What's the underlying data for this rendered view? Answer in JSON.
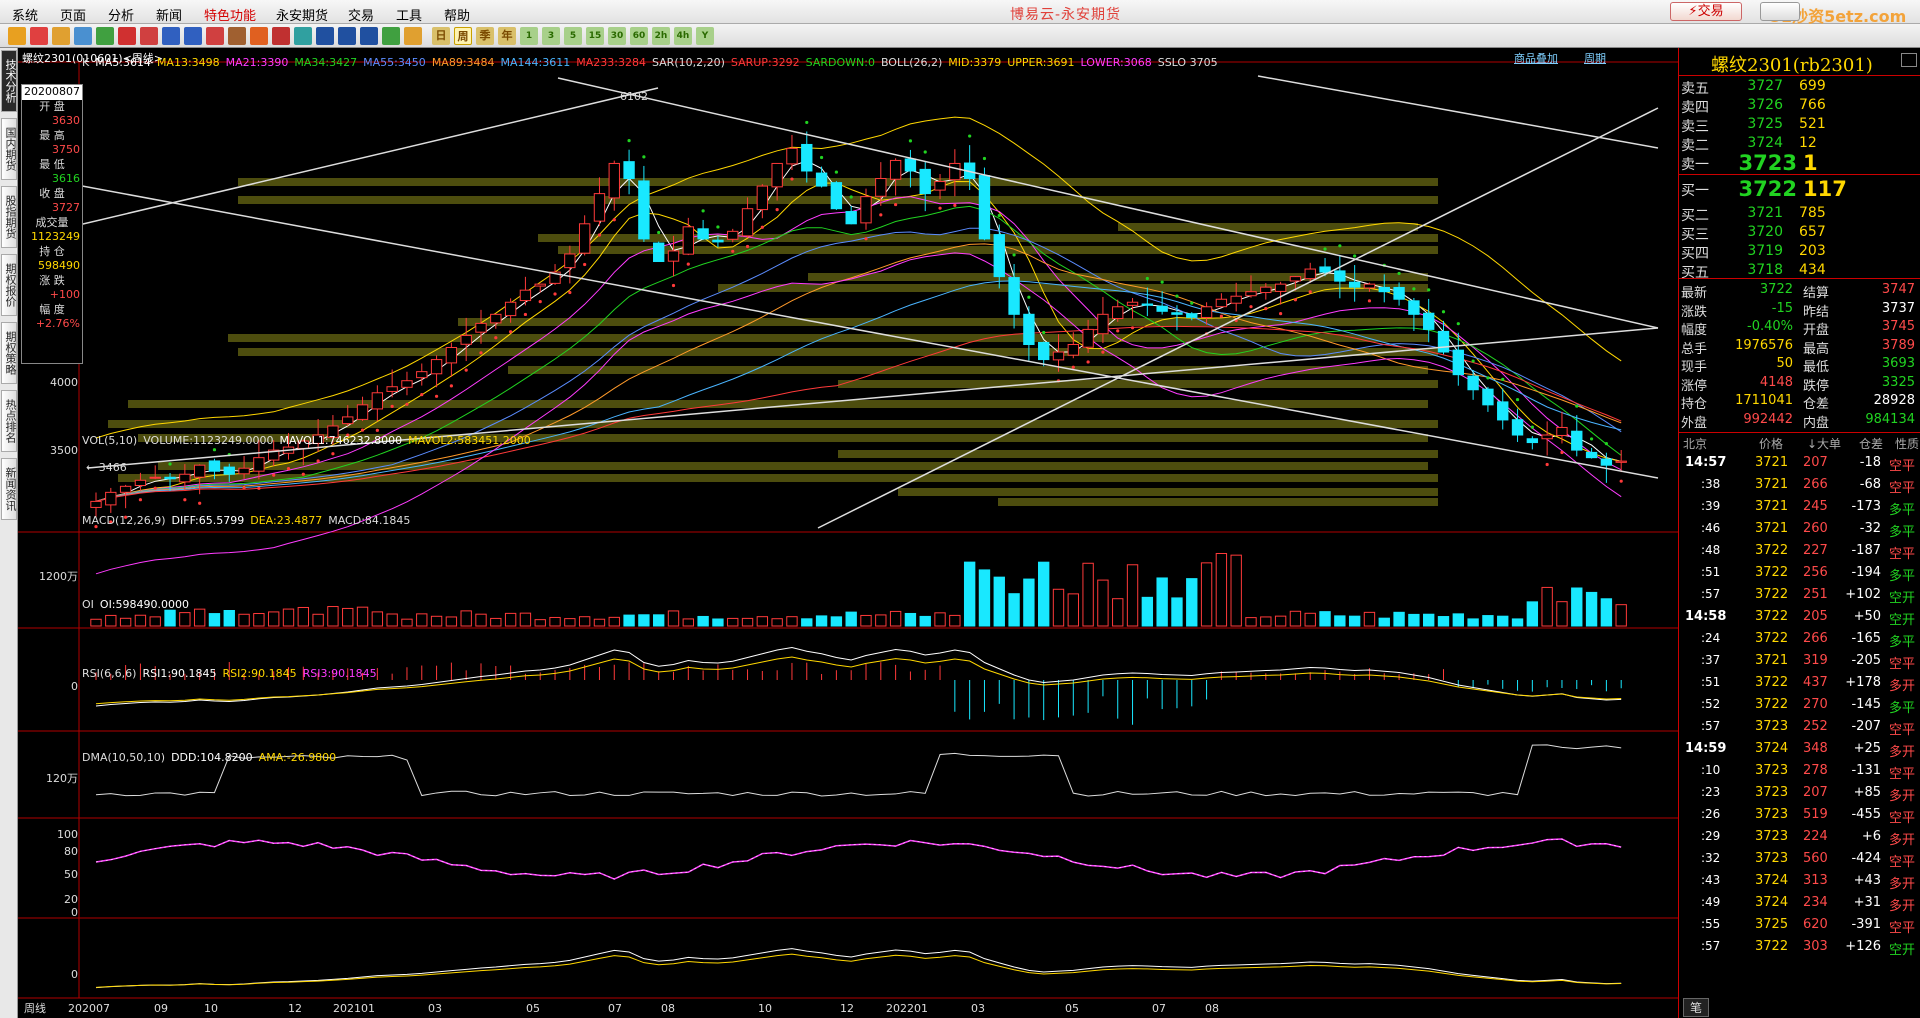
{
  "menu": [
    "系统",
    "页面",
    "分析",
    "新闻",
    "特色功能",
    "永安期货",
    "交易",
    "工具",
    "帮助"
  ],
  "menu_active": 4,
  "app_title": "博易云-永安期货",
  "trade_button": "交易",
  "watermark": "5E炒资5etz.com",
  "toolbar_period_buttons": [
    "日",
    "周",
    "季",
    "年",
    "1",
    "3",
    "5",
    "15",
    "30",
    "60",
    "2h",
    "4h",
    "Y"
  ],
  "left_tabs": [
    "技术分析",
    "国内期货",
    "股指期货",
    "期权报价",
    "期权策略",
    "热点排名",
    "新闻资讯"
  ],
  "chart": {
    "title": "螺纹2301(010601)<周线>",
    "links": [
      "商品叠加",
      "周期"
    ],
    "ma_legend": [
      {
        "text": "K",
        "color": "#ddd"
      },
      {
        "text": "MA5:3614",
        "color": "#fff"
      },
      {
        "text": "MA13:3498",
        "color": "#ffd700"
      },
      {
        "text": "MA21:3390",
        "color": "#ff3cff"
      },
      {
        "text": "MA34:3427",
        "color": "#21d321"
      },
      {
        "text": "MA55:3450",
        "color": "#5b8cff"
      },
      {
        "text": "MA89:3484",
        "color": "#ff9a2a"
      },
      {
        "text": "MA144:3611",
        "color": "#4ab4ff"
      },
      {
        "text": "MA233:3284",
        "color": "#ff3a3a"
      },
      {
        "text": "SAR(10,2,20)",
        "color": "#ddd"
      },
      {
        "text": "SARUP:3292",
        "color": "#ff3a3a"
      },
      {
        "text": "SARDOWN:0",
        "color": "#21d321"
      },
      {
        "text": "BOLL(26,2)",
        "color": "#ddd"
      },
      {
        "text": "MID:3379",
        "color": "#ffd700"
      },
      {
        "text": "UPPER:3691",
        "color": "#ffd700"
      },
      {
        "text": "LOWER:3068",
        "color": "#ff3cff"
      },
      {
        "text": "SSLO 3705",
        "color": "#ddd"
      }
    ],
    "price_labels": [
      "4000",
      "3500"
    ],
    "high_label": "6102",
    "low_label": "3466",
    "info_box": {
      "date": "20200807",
      "items": [
        {
          "k": "开  盘",
          "v": "3630",
          "c": "red"
        },
        {
          "k": "最  高",
          "v": "3750",
          "c": "red"
        },
        {
          "k": "最  低",
          "v": "3616",
          "c": "grn"
        },
        {
          "k": "收  盘",
          "v": "3727",
          "c": "red"
        },
        {
          "k": "成交量",
          "v": "1123249",
          "c": "yel"
        },
        {
          "k": "持  仓",
          "v": "598490",
          "c": "yel"
        },
        {
          "k": "涨  跌",
          "v": "+100",
          "c": "red"
        },
        {
          "k": "幅  度",
          "v": "+2.76%",
          "c": "red"
        }
      ]
    },
    "vol_legend": [
      {
        "text": "VOL(5,10)",
        "color": "#ddd"
      },
      {
        "text": "VOLUME:1123249.0000",
        "color": "#ddd"
      },
      {
        "text": "MAVOL1:746232.8000",
        "color": "#fff"
      },
      {
        "text": "MAVOL2:583451.2000",
        "color": "#ffd700"
      }
    ],
    "vol_label": "1200万",
    "macd_legend": [
      {
        "text": "MACD(12,26,9)",
        "color": "#ddd"
      },
      {
        "text": "DIFF:65.5799",
        "color": "#fff"
      },
      {
        "text": "DEA:23.4877",
        "color": "#ffd700"
      },
      {
        "text": "MACD:84.1845",
        "color": "#ddd"
      }
    ],
    "macd_label": "0",
    "oi_legend": [
      {
        "text": "OI",
        "color": "#ddd"
      },
      {
        "text": "OI:598490.0000",
        "color": "#fff"
      }
    ],
    "oi_label": "120万",
    "rsi_legend": [
      {
        "text": "RSI(6,6,6)",
        "color": "#ddd"
      },
      {
        "text": "RSI1:90.1845",
        "color": "#fff"
      },
      {
        "text": "RSI2:90.1845",
        "color": "#ffd700"
      },
      {
        "text": "RSI3:90.1845",
        "color": "#ff3cff"
      }
    ],
    "rsi_labels": [
      "100",
      "80",
      "50",
      "20",
      "0"
    ],
    "dma_legend": [
      {
        "text": "DMA(10,50,10)",
        "color": "#ddd"
      },
      {
        "text": "DDD:104.8200",
        "color": "#fff"
      },
      {
        "text": "AMA:-26.9800",
        "color": "#ffd700"
      }
    ],
    "dma_label": "0",
    "axis_name": "周线",
    "x_ticks": [
      "202007",
      "09",
      "10",
      "12",
      "202101",
      "03",
      "05",
      "07",
      "08",
      "10",
      "12",
      "202201",
      "03",
      "05",
      "07",
      "08"
    ]
  },
  "quote": {
    "title": "螺纹2301(rb2301)",
    "asks": [
      {
        "label": "卖五",
        "price": "3727",
        "vol": "699"
      },
      {
        "label": "卖四",
        "price": "3726",
        "vol": "766"
      },
      {
        "label": "卖三",
        "price": "3725",
        "vol": "521"
      },
      {
        "label": "卖二",
        "price": "3724",
        "vol": "12"
      },
      {
        "label": "卖一",
        "price": "3723",
        "vol": "1"
      }
    ],
    "bids": [
      {
        "label": "买一",
        "price": "3722",
        "vol": "117"
      },
      {
        "label": "买二",
        "price": "3721",
        "vol": "785"
      },
      {
        "label": "买三",
        "price": "3720",
        "vol": "657"
      },
      {
        "label": "买四",
        "price": "3719",
        "vol": "203"
      },
      {
        "label": "买五",
        "price": "3718",
        "vol": "434"
      }
    ],
    "stats": [
      {
        "k1": "最新",
        "v1": "3722",
        "c1": "grn",
        "k2": "结算",
        "v2": "3747",
        "c2": "red"
      },
      {
        "k1": "涨跌",
        "v1": "-15",
        "c1": "grn",
        "k2": "昨结",
        "v2": "3737",
        "c2": "wht"
      },
      {
        "k1": "幅度",
        "v1": "-0.40%",
        "c1": "grn",
        "k2": "开盘",
        "v2": "3745",
        "c2": "red"
      },
      {
        "k1": "总手",
        "v1": "1976576",
        "c1": "yel",
        "k2": "最高",
        "v2": "3789",
        "c2": "red"
      },
      {
        "k1": "现手",
        "v1": "50",
        "c1": "yel",
        "k2": "最低",
        "v2": "3693",
        "c2": "grn"
      },
      {
        "k1": "涨停",
        "v1": "4148",
        "c1": "red",
        "k2": "跌停",
        "v2": "3325",
        "c2": "grn"
      },
      {
        "k1": "持仓",
        "v1": "1711041",
        "c1": "yel",
        "k2": "仓差",
        "v2": "28928",
        "c2": "wht"
      },
      {
        "k1": "外盘",
        "v1": "992442",
        "c1": "red",
        "k2": "内盘",
        "v2": "984134",
        "c2": "grn"
      }
    ],
    "tick_headers": [
      "北京",
      "价格",
      "↓大单",
      "仓差",
      "性质"
    ],
    "ticks": [
      {
        "t": "14:57",
        "p": "3721",
        "v": "207",
        "d": "-18",
        "n": "空平",
        "c": "red"
      },
      {
        "t": ":38",
        "p": "3721",
        "v": "266",
        "d": "-68",
        "n": "空平",
        "c": "red"
      },
      {
        "t": ":39",
        "p": "3721",
        "v": "245",
        "d": "-173",
        "n": "多平",
        "c": "grn"
      },
      {
        "t": ":46",
        "p": "3721",
        "v": "260",
        "d": "-32",
        "n": "多平",
        "c": "grn"
      },
      {
        "t": ":48",
        "p": "3722",
        "v": "227",
        "d": "-187",
        "n": "空平",
        "c": "red"
      },
      {
        "t": ":51",
        "p": "3722",
        "v": "256",
        "d": "-194",
        "n": "多平",
        "c": "grn"
      },
      {
        "t": ":57",
        "p": "3722",
        "v": "251",
        "d": "+102",
        "n": "空开",
        "c": "grn"
      },
      {
        "t": "14:58",
        "p": "3722",
        "v": "205",
        "d": "+50",
        "n": "空开",
        "c": "grn"
      },
      {
        "t": ":24",
        "p": "3722",
        "v": "266",
        "d": "-165",
        "n": "多平",
        "c": "grn"
      },
      {
        "t": ":37",
        "p": "3721",
        "v": "319",
        "d": "-205",
        "n": "空平",
        "c": "red"
      },
      {
        "t": ":51",
        "p": "3722",
        "v": "437",
        "d": "+178",
        "n": "多开",
        "c": "red"
      },
      {
        "t": ":52",
        "p": "3722",
        "v": "270",
        "d": "-145",
        "n": "多平",
        "c": "grn"
      },
      {
        "t": ":57",
        "p": "3723",
        "v": "252",
        "d": "-207",
        "n": "空平",
        "c": "red"
      },
      {
        "t": "14:59",
        "p": "3724",
        "v": "348",
        "d": "+25",
        "n": "多开",
        "c": "red"
      },
      {
        "t": ":10",
        "p": "3723",
        "v": "278",
        "d": "-131",
        "n": "空平",
        "c": "red"
      },
      {
        "t": ":23",
        "p": "3723",
        "v": "207",
        "d": "+85",
        "n": "多开",
        "c": "red"
      },
      {
        "t": ":26",
        "p": "3723",
        "v": "519",
        "d": "-455",
        "n": "空平",
        "c": "red"
      },
      {
        "t": ":29",
        "p": "3723",
        "v": "224",
        "d": "+6",
        "n": "多开",
        "c": "red"
      },
      {
        "t": ":32",
        "p": "3723",
        "v": "560",
        "d": "-424",
        "n": "空平",
        "c": "red"
      },
      {
        "t": ":43",
        "p": "3724",
        "v": "313",
        "d": "+43",
        "n": "多开",
        "c": "red"
      },
      {
        "t": ":49",
        "p": "3724",
        "v": "234",
        "d": "+31",
        "n": "多开",
        "c": "red"
      },
      {
        "t": ":55",
        "p": "3725",
        "v": "620",
        "d": "-391",
        "n": "空平",
        "c": "red"
      },
      {
        "t": ":57",
        "p": "3722",
        "v": "303",
        "d": "+126",
        "n": "空开",
        "c": "grn"
      }
    ],
    "footer_tab": "笔"
  }
}
